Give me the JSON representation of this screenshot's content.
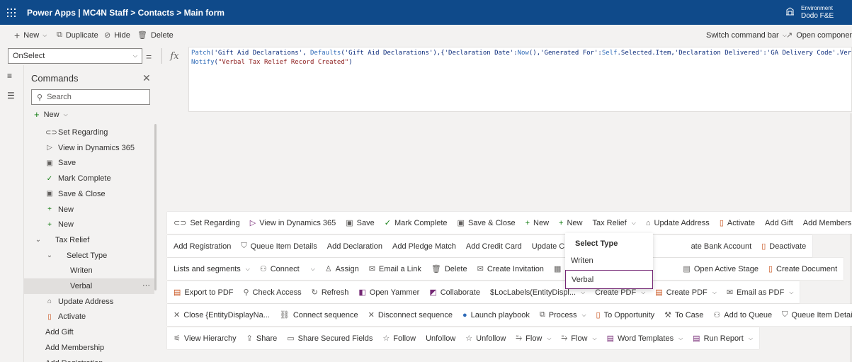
{
  "header": {
    "app_title": "Power Apps | MC4N Staff > Contacts > Main form",
    "environment_label": "Environment",
    "environment_name": "Dodo F&E"
  },
  "command_bar": {
    "new": "New",
    "duplicate": "Duplicate",
    "hide": "Hide",
    "delete": "Delete",
    "switch": "Switch command bar",
    "open_component": "Open component"
  },
  "formula_bar": {
    "property": "OnSelect",
    "fx": "fx",
    "line1": [
      [
        "Patch",
        "fn"
      ],
      [
        "('Gift Aid Declarations', ",
        ""
      ],
      [
        "Defaults",
        "fn"
      ],
      [
        "('Gift Aid Declarations'),{'Declaration Date':",
        ""
      ],
      [
        "Now",
        "fn"
      ],
      [
        "(),'Generated For':",
        ""
      ],
      [
        "Self",
        "fn"
      ],
      [
        ".Selected.Item,'Declaration Delivered':'GA Delivery Code'.Verbal});",
        ""
      ]
    ],
    "line2": [
      [
        "Notify",
        "fn"
      ],
      [
        "(",
        ""
      ],
      [
        "\"Verbal Tax Relief Record Created\"",
        "str"
      ],
      [
        ")",
        ""
      ]
    ]
  },
  "panel": {
    "title": "Commands",
    "search_placeholder": "Search",
    "new_label": "New",
    "tree": [
      {
        "label": "Set Regarding",
        "icon": "link-icon",
        "glyph": "⊂⊃",
        "indent": 0,
        "expander": ""
      },
      {
        "label": "View in Dynamics 365",
        "icon": "play-icon",
        "glyph": "▷",
        "indent": 0,
        "expander": ""
      },
      {
        "label": "Save",
        "icon": "save-icon",
        "glyph": "▣",
        "indent": 0,
        "expander": ""
      },
      {
        "label": "Mark Complete",
        "icon": "check-icon",
        "glyph": "✓",
        "indent": 0,
        "expander": ""
      },
      {
        "label": "Save & Close",
        "icon": "save-close-icon",
        "glyph": "▣",
        "indent": 0,
        "expander": ""
      },
      {
        "label": "New",
        "icon": "plus-icon",
        "glyph": "+",
        "indent": 0,
        "expander": ""
      },
      {
        "label": "New",
        "icon": "plus-icon",
        "glyph": "+",
        "indent": 0,
        "expander": ""
      },
      {
        "label": "Tax Relief",
        "icon": "",
        "glyph": "",
        "indent": 0,
        "expander": "⌄"
      },
      {
        "label": "Select Type",
        "icon": "",
        "glyph": "",
        "indent": 1,
        "expander": "⌄"
      },
      {
        "label": "Writen",
        "icon": "",
        "glyph": "",
        "indent": 2,
        "expander": ""
      },
      {
        "label": "Verbal",
        "icon": "",
        "glyph": "",
        "indent": 2,
        "expander": "",
        "selected": true,
        "more": "···"
      },
      {
        "label": "Update Address",
        "icon": "home-icon",
        "glyph": "⌂",
        "indent": 0,
        "expander": ""
      },
      {
        "label": "Activate",
        "icon": "document-icon",
        "glyph": "▯",
        "indent": 0,
        "expander": ""
      },
      {
        "label": "Add Gift",
        "icon": "",
        "glyph": "",
        "indent": 0,
        "expander": ""
      },
      {
        "label": "Add Membership",
        "icon": "",
        "glyph": "",
        "indent": 0,
        "expander": ""
      },
      {
        "label": "Add Registration",
        "icon": "",
        "glyph": "",
        "indent": 0,
        "expander": ""
      }
    ]
  },
  "canvas_rows": [
    [
      {
        "label": "Set Regarding",
        "icon": "link-icon",
        "glyph": "⊂⊃"
      },
      {
        "label": "View in Dynamics 365",
        "icon": "play-icon",
        "glyph": "▷"
      },
      {
        "label": "Save",
        "icon": "save-icon",
        "glyph": "▣"
      },
      {
        "label": "Mark Complete",
        "icon": "check-icon",
        "glyph": "✓"
      },
      {
        "label": "Save & Close",
        "icon": "save-close-icon",
        "glyph": "▣"
      },
      {
        "label": "New",
        "icon": "plus-icon",
        "glyph": "+"
      },
      {
        "label": "New",
        "icon": "plus-icon",
        "glyph": "+"
      },
      {
        "label": "Tax Relief",
        "icon": "",
        "glyph": "",
        "chevron": true
      },
      {
        "label": "Update Address",
        "icon": "home-icon",
        "glyph": "⌂"
      },
      {
        "label": "Activate",
        "icon": "document-icon",
        "glyph": "▯"
      },
      {
        "label": "Add Gift",
        "icon": "",
        "glyph": ""
      },
      {
        "label": "Add Membership",
        "icon": "",
        "glyph": ""
      }
    ],
    [
      {
        "label": "Add Registration",
        "icon": "",
        "glyph": ""
      },
      {
        "label": "Queue Item Details",
        "icon": "queue-icon",
        "glyph": "⛉"
      },
      {
        "label": "Add Declaration",
        "icon": "",
        "glyph": ""
      },
      {
        "label": "Add Pledge Match",
        "icon": "",
        "glyph": ""
      },
      {
        "label": "Add Credit Card",
        "icon": "",
        "glyph": ""
      },
      {
        "label": "Update Credit Card",
        "icon": "",
        "glyph": ""
      },
      {
        "label": "",
        "icon": "",
        "glyph": "",
        "spacer": true
      },
      {
        "label": "ate Bank Account",
        "icon": "",
        "glyph": ""
      },
      {
        "label": "Deactivate",
        "icon": "document-icon",
        "glyph": "▯"
      }
    ],
    [
      {
        "label": "Lists and segments",
        "icon": "",
        "glyph": "",
        "chevron": true
      },
      {
        "label": "Connect",
        "icon": "people-icon",
        "glyph": "⚇"
      },
      {
        "label": "",
        "icon": "",
        "glyph": "",
        "chevron": true
      },
      {
        "label": "Assign",
        "icon": "person-icon",
        "glyph": "♙"
      },
      {
        "label": "Email a Link",
        "icon": "mail-icon",
        "glyph": "✉"
      },
      {
        "label": "Delete",
        "icon": "trash-icon",
        "glyph": "🗑"
      },
      {
        "label": "Create Invitation",
        "icon": "invitation-icon",
        "glyph": "✉"
      },
      {
        "label": "Book",
        "icon": "calendar-icon",
        "glyph": "▦"
      },
      {
        "label": "",
        "icon": "",
        "glyph": "",
        "spacer": true
      },
      {
        "label": "Open Active Stage",
        "icon": "stage-icon",
        "glyph": "▤"
      },
      {
        "label": "Create Document",
        "icon": "document-icon",
        "glyph": "▯"
      }
    ],
    [
      {
        "label": "Export to PDF",
        "icon": "pdf-icon",
        "glyph": "▤"
      },
      {
        "label": "Check Access",
        "icon": "search-icon",
        "glyph": "⚲"
      },
      {
        "label": "Refresh",
        "icon": "refresh-icon",
        "glyph": "↻"
      },
      {
        "label": "Open Yammer",
        "icon": "yammer-icon",
        "glyph": "◧"
      },
      {
        "label": "Collaborate",
        "icon": "teams-icon",
        "glyph": "◩"
      },
      {
        "label": "$LocLabels(EntityDispl...",
        "icon": "",
        "glyph": "",
        "chevron": true
      },
      {
        "label": "Create PDF",
        "icon": "",
        "glyph": "",
        "chevron": true
      },
      {
        "label": "Create PDF",
        "icon": "pdf-icon",
        "glyph": "▤",
        "chevron": true
      },
      {
        "label": "Email as PDF",
        "icon": "mail-icon",
        "glyph": "✉",
        "chevron": true
      }
    ],
    [
      {
        "label": "Close {EntityDisplayNa...",
        "icon": "close-icon",
        "glyph": "✕"
      },
      {
        "label": "Connect sequence",
        "icon": "sequence-icon",
        "glyph": "⛓"
      },
      {
        "label": "Disconnect sequence",
        "icon": "close-icon",
        "glyph": "✕"
      },
      {
        "label": "Launch playbook",
        "icon": "playbook-icon",
        "glyph": "●"
      },
      {
        "label": "Process",
        "icon": "process-icon",
        "glyph": "⧉",
        "chevron": true
      },
      {
        "label": "To Opportunity",
        "icon": "document-icon",
        "glyph": "▯"
      },
      {
        "label": "To Case",
        "icon": "wrench-icon",
        "glyph": "⚒"
      },
      {
        "label": "Add to Queue",
        "icon": "queue-icon",
        "glyph": "⚇"
      },
      {
        "label": "Queue Item Details",
        "icon": "queue-icon",
        "glyph": "⛉"
      }
    ],
    [
      {
        "label": "View Hierarchy",
        "icon": "hierarchy-icon",
        "glyph": "⚟"
      },
      {
        "label": "Share",
        "icon": "share-icon",
        "glyph": "⇪"
      },
      {
        "label": "Share Secured Fields",
        "icon": "share-fields-icon",
        "glyph": "▭"
      },
      {
        "label": "Follow",
        "icon": "star-icon",
        "glyph": "☆"
      },
      {
        "label": "Unfollow",
        "icon": "",
        "glyph": ""
      },
      {
        "label": "Unfollow",
        "icon": "star-icon",
        "glyph": "☆"
      },
      {
        "label": "Flow",
        "icon": "flow-icon",
        "glyph": "⥲",
        "chevron": true
      },
      {
        "label": "Flow",
        "icon": "flow-icon",
        "glyph": "⥲",
        "chevron": true
      },
      {
        "label": "Word Templates",
        "icon": "word-icon",
        "glyph": "▤",
        "chevron": true
      },
      {
        "label": "Run Report",
        "icon": "report-icon",
        "glyph": "▤",
        "chevron": true
      }
    ]
  ],
  "flyout": {
    "title": "Select Type",
    "item1": "Writen",
    "item2": "Verbal"
  }
}
